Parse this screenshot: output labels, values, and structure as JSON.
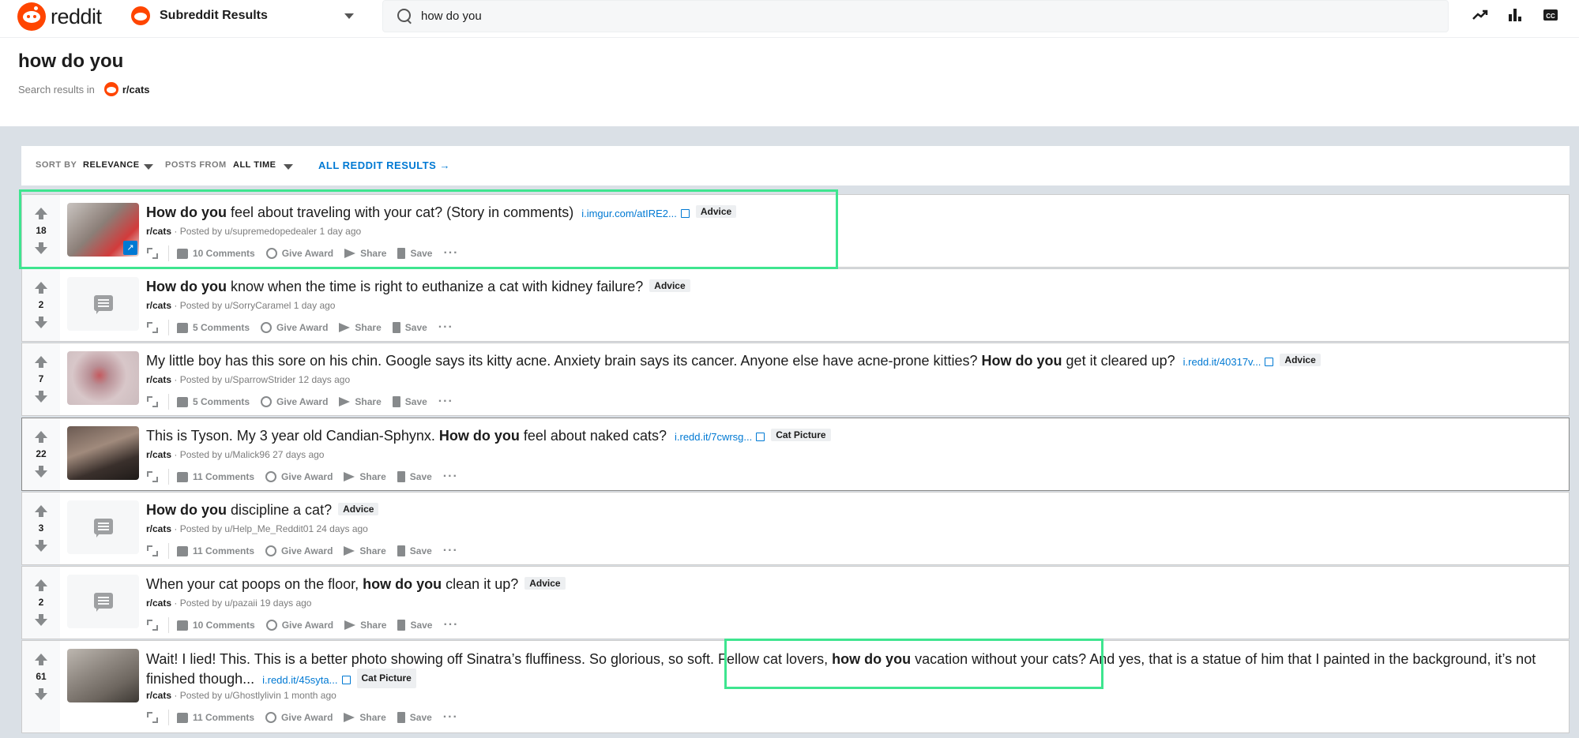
{
  "header": {
    "logo_text": "reddit",
    "subreddit_dropdown_label": "Subreddit Results",
    "search_value": "how do you",
    "icons": [
      "trending-icon",
      "leaderboard-icon",
      "closed-captions-icon"
    ]
  },
  "title_area": {
    "title": "how do you",
    "results_in_label": "Search results in",
    "subreddit": "r/cats"
  },
  "filters": {
    "sort_label": "SORT BY",
    "sort_value": "RELEVANCE",
    "from_label": "POSTS FROM",
    "from_value": "ALL TIME",
    "all_results": "ALL REDDIT RESULTS →"
  },
  "action_labels": {
    "give_award": "Give Award",
    "share": "Share",
    "save": "Save",
    "more": "···"
  },
  "posts": [
    {
      "score": "18",
      "title_bold": "How do you",
      "title_rest": " feel about traveling with your cat? (Story in comments)",
      "domain": "i.imgur.com/atIRE2...",
      "flair": "Advice",
      "subreddit": "r/cats",
      "meta": " · Posted by u/supremedopedealer 1 day ago",
      "comments": "10 Comments",
      "thumb": "image"
    },
    {
      "score": "2",
      "title_bold": "How do you",
      "title_rest": " know when the time is right to euthanize a cat with kidney failure?",
      "flair": "Advice",
      "subreddit": "r/cats",
      "meta": " · Posted by u/SorryCaramel 1 day ago",
      "comments": "5 Comments",
      "thumb": "text"
    },
    {
      "score": "7",
      "title_pre": "My little boy has this sore on his chin. Google says its kitty acne. Anxiety brain says its cancer. Anyone else have acne-prone kitties? ",
      "title_bold": "How do you",
      "title_rest": " get it cleared up?",
      "domain": "i.redd.it/40317v...",
      "flair": "Advice",
      "subreddit": "r/cats",
      "meta": " · Posted by u/SparrowStrider 12 days ago",
      "comments": "5 Comments",
      "thumb": "image"
    },
    {
      "score": "22",
      "title_pre": "This is Tyson. My 3 year old Candian-Sphynx. ",
      "title_bold": "How do you",
      "title_rest": " feel about naked cats?",
      "domain": "i.redd.it/7cwrsg...",
      "flair": "Cat Picture",
      "subreddit": "r/cats",
      "meta": " · Posted by u/Malick96 27 days ago",
      "comments": "11 Comments",
      "thumb": "image"
    },
    {
      "score": "3",
      "title_bold": "How do you",
      "title_rest": " discipline a cat?",
      "flair": "Advice",
      "subreddit": "r/cats",
      "meta": " · Posted by u/Help_Me_Reddit01 24 days ago",
      "comments": "11 Comments",
      "thumb": "text"
    },
    {
      "score": "2",
      "title_pre": "When your cat poops on the floor, ",
      "title_bold": "how do you",
      "title_rest": " clean it up?",
      "flair": "Advice",
      "subreddit": "r/cats",
      "meta": " · Posted by u/pazaii 19 days ago",
      "comments": "10 Comments",
      "thumb": "text"
    },
    {
      "score": "61",
      "title_pre": "Wait! I lied! This. This is a better photo showing off Sinatra’s fluffiness. So glorious, so soft. Fellow cat lovers, ",
      "title_bold": "how do you",
      "title_rest": " vacation without your cats? And yes, that is a statue of him that I painted in the background, it’s not finished though...",
      "domain": "i.redd.it/45syta...",
      "flair": "Cat Picture",
      "subreddit": "r/cats",
      "meta": " · Posted by u/Ghostlylivin 1 month ago",
      "comments": "11 Comments",
      "thumb": "image"
    }
  ],
  "colors": {
    "accent": "#0079d3",
    "brand": "#ff4500",
    "highlight": "#3ee58f"
  }
}
